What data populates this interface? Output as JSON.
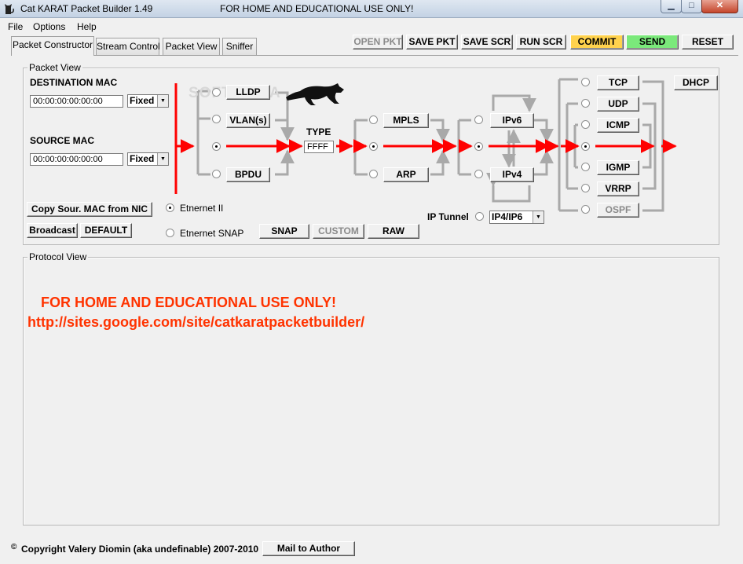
{
  "window": {
    "title": "Cat KARAT Packet Builder 1.49",
    "notice": "FOR HOME AND EDUCATIONAL USE ONLY!",
    "minimize": "▁",
    "maximize": "□",
    "close": "✕"
  },
  "menu": [
    "File",
    "Options",
    "Help"
  ],
  "tabs": [
    "Packet Constructor",
    "Stream Control",
    "Packet View",
    "Sniffer"
  ],
  "toolbar": {
    "open_pkt": "OPEN PKT",
    "save_pkt": "SAVE PKT",
    "save_scr": "SAVE SCR",
    "run_scr": "RUN SCR",
    "commit": "COMMIT",
    "send": "SEND",
    "reset": "RESET"
  },
  "packet_view": {
    "title": "Packet View",
    "dest_mac_label": "DESTINATION MAC",
    "dest_mac_value": "00:00:00:00:00:00",
    "dest_mode": "Fixed",
    "src_mac_label": "SOURCE MAC",
    "src_mac_value": "00:00:00:00:00:00",
    "src_mode": "Fixed",
    "copy_mac": "Copy Sour. MAC from NIC",
    "broadcast": "Broadcast",
    "default": "DEFAULT",
    "ethernet2": "Etnernet II",
    "ethernet_snap": "Etnernet SNAP",
    "snap": "SNAP",
    "custom": "CUSTOM",
    "raw": "RAW",
    "type_label": "TYPE",
    "type_value": "FFFF",
    "l2": [
      "LLDP",
      "VLAN(s)",
      "BPDU"
    ],
    "l25": [
      "MPLS",
      "ARP"
    ],
    "l3": [
      "IPv6",
      "IPv4"
    ],
    "ip_tunnel_label": "IP Tunnel",
    "ip_tunnel_value": "IP4/IP6",
    "l4": [
      "TCP",
      "UDP",
      "ICMP",
      "IGMP",
      "VRRP",
      "OSPF"
    ],
    "dhcp": "DHCP",
    "watermark": "SOFTPEDIA"
  },
  "protocol_view": {
    "title": "Protocol View",
    "notice": "FOR HOME AND EDUCATIONAL USE ONLY!",
    "url": "http://sites.google.com/site/catkaratpacketbuilder/"
  },
  "footer": {
    "copyright": "Copyright Valery Diomin (aka undefinable) 2007-2010",
    "copyright_symbol": "©",
    "mail": "Mail to Author"
  },
  "colors": {
    "commit_bg": "#ffd24d",
    "send_bg": "#7be97b",
    "flow_arrow": "#ff0000",
    "branch_line": "#a9a9a9",
    "promo_text": "#ff3300"
  }
}
